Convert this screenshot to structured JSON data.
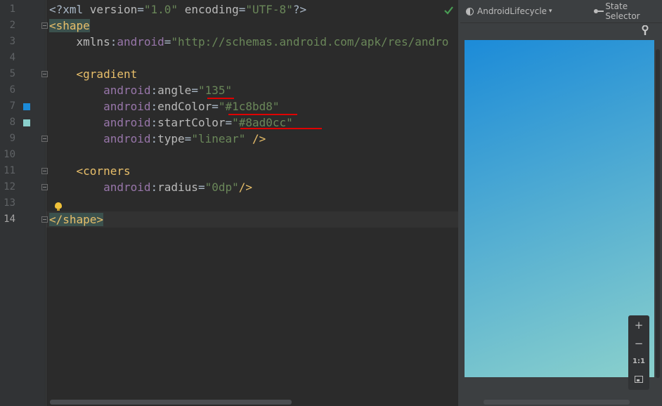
{
  "gutter": {
    "line_numbers": [
      "1",
      "2",
      "3",
      "4",
      "5",
      "6",
      "7",
      "8",
      "9",
      "10",
      "11",
      "12",
      "13",
      "14"
    ],
    "active_line": "14",
    "color_swatches": {
      "line7": "#1c8bd8",
      "line8": "#8ad0cc"
    }
  },
  "code": {
    "l1": {
      "a": "<?xml ",
      "b": "version",
      "c": "=",
      "d": "\"1.0\"",
      "e": " ",
      "f": "encoding",
      "g": "=",
      "h": "\"UTF-8\"",
      "i": "?>"
    },
    "l2": {
      "tag": "<shape"
    },
    "l3": {
      "indent": "    ",
      "ns": "xmlns",
      "colon": ":",
      "attr": "android",
      "eq": "=",
      "val": "\"http://schemas.android.com/apk/res/andro"
    },
    "l5": {
      "indent": "    ",
      "tag": "<gradient"
    },
    "l6": {
      "indent": "        ",
      "ns": "android",
      "colon": ":",
      "attr": "angle",
      "eq": "=",
      "val": "\"135\""
    },
    "l7": {
      "indent": "        ",
      "ns": "android",
      "colon": ":",
      "attr": "endColor",
      "eq": "=",
      "val": "\"#1c8bd8\""
    },
    "l8": {
      "indent": "        ",
      "ns": "android",
      "colon": ":",
      "attr": "startColor",
      "eq": "=",
      "val": "\"#8ad0cc\""
    },
    "l9": {
      "indent": "        ",
      "ns": "android",
      "colon": ":",
      "attr": "type",
      "eq": "=",
      "val": "\"linear\"",
      "close": " />"
    },
    "l11": {
      "indent": "    ",
      "tag": "<corners"
    },
    "l12": {
      "indent": "        ",
      "ns": "android",
      "colon": ":",
      "attr": "radius",
      "eq": "=",
      "val": "\"0dp\"",
      "close": "/>"
    },
    "l14": {
      "tag": "</shape>"
    }
  },
  "preview": {
    "layout_selector": "AndroidLifecycle",
    "state_selector": "State Selector",
    "zoom_in": "+",
    "zoom_out": "−",
    "zoom_actual": "1:1",
    "gradient": {
      "start": "#8ad0cc",
      "end": "#1c8bd8",
      "angle": "135"
    }
  },
  "icons": [
    "check-icon",
    "bulb-icon",
    "wrench-icon",
    "layout-circle-icon",
    "state-selector-icon",
    "chevron-down-icon",
    "zoom-to-fit-icon"
  ]
}
